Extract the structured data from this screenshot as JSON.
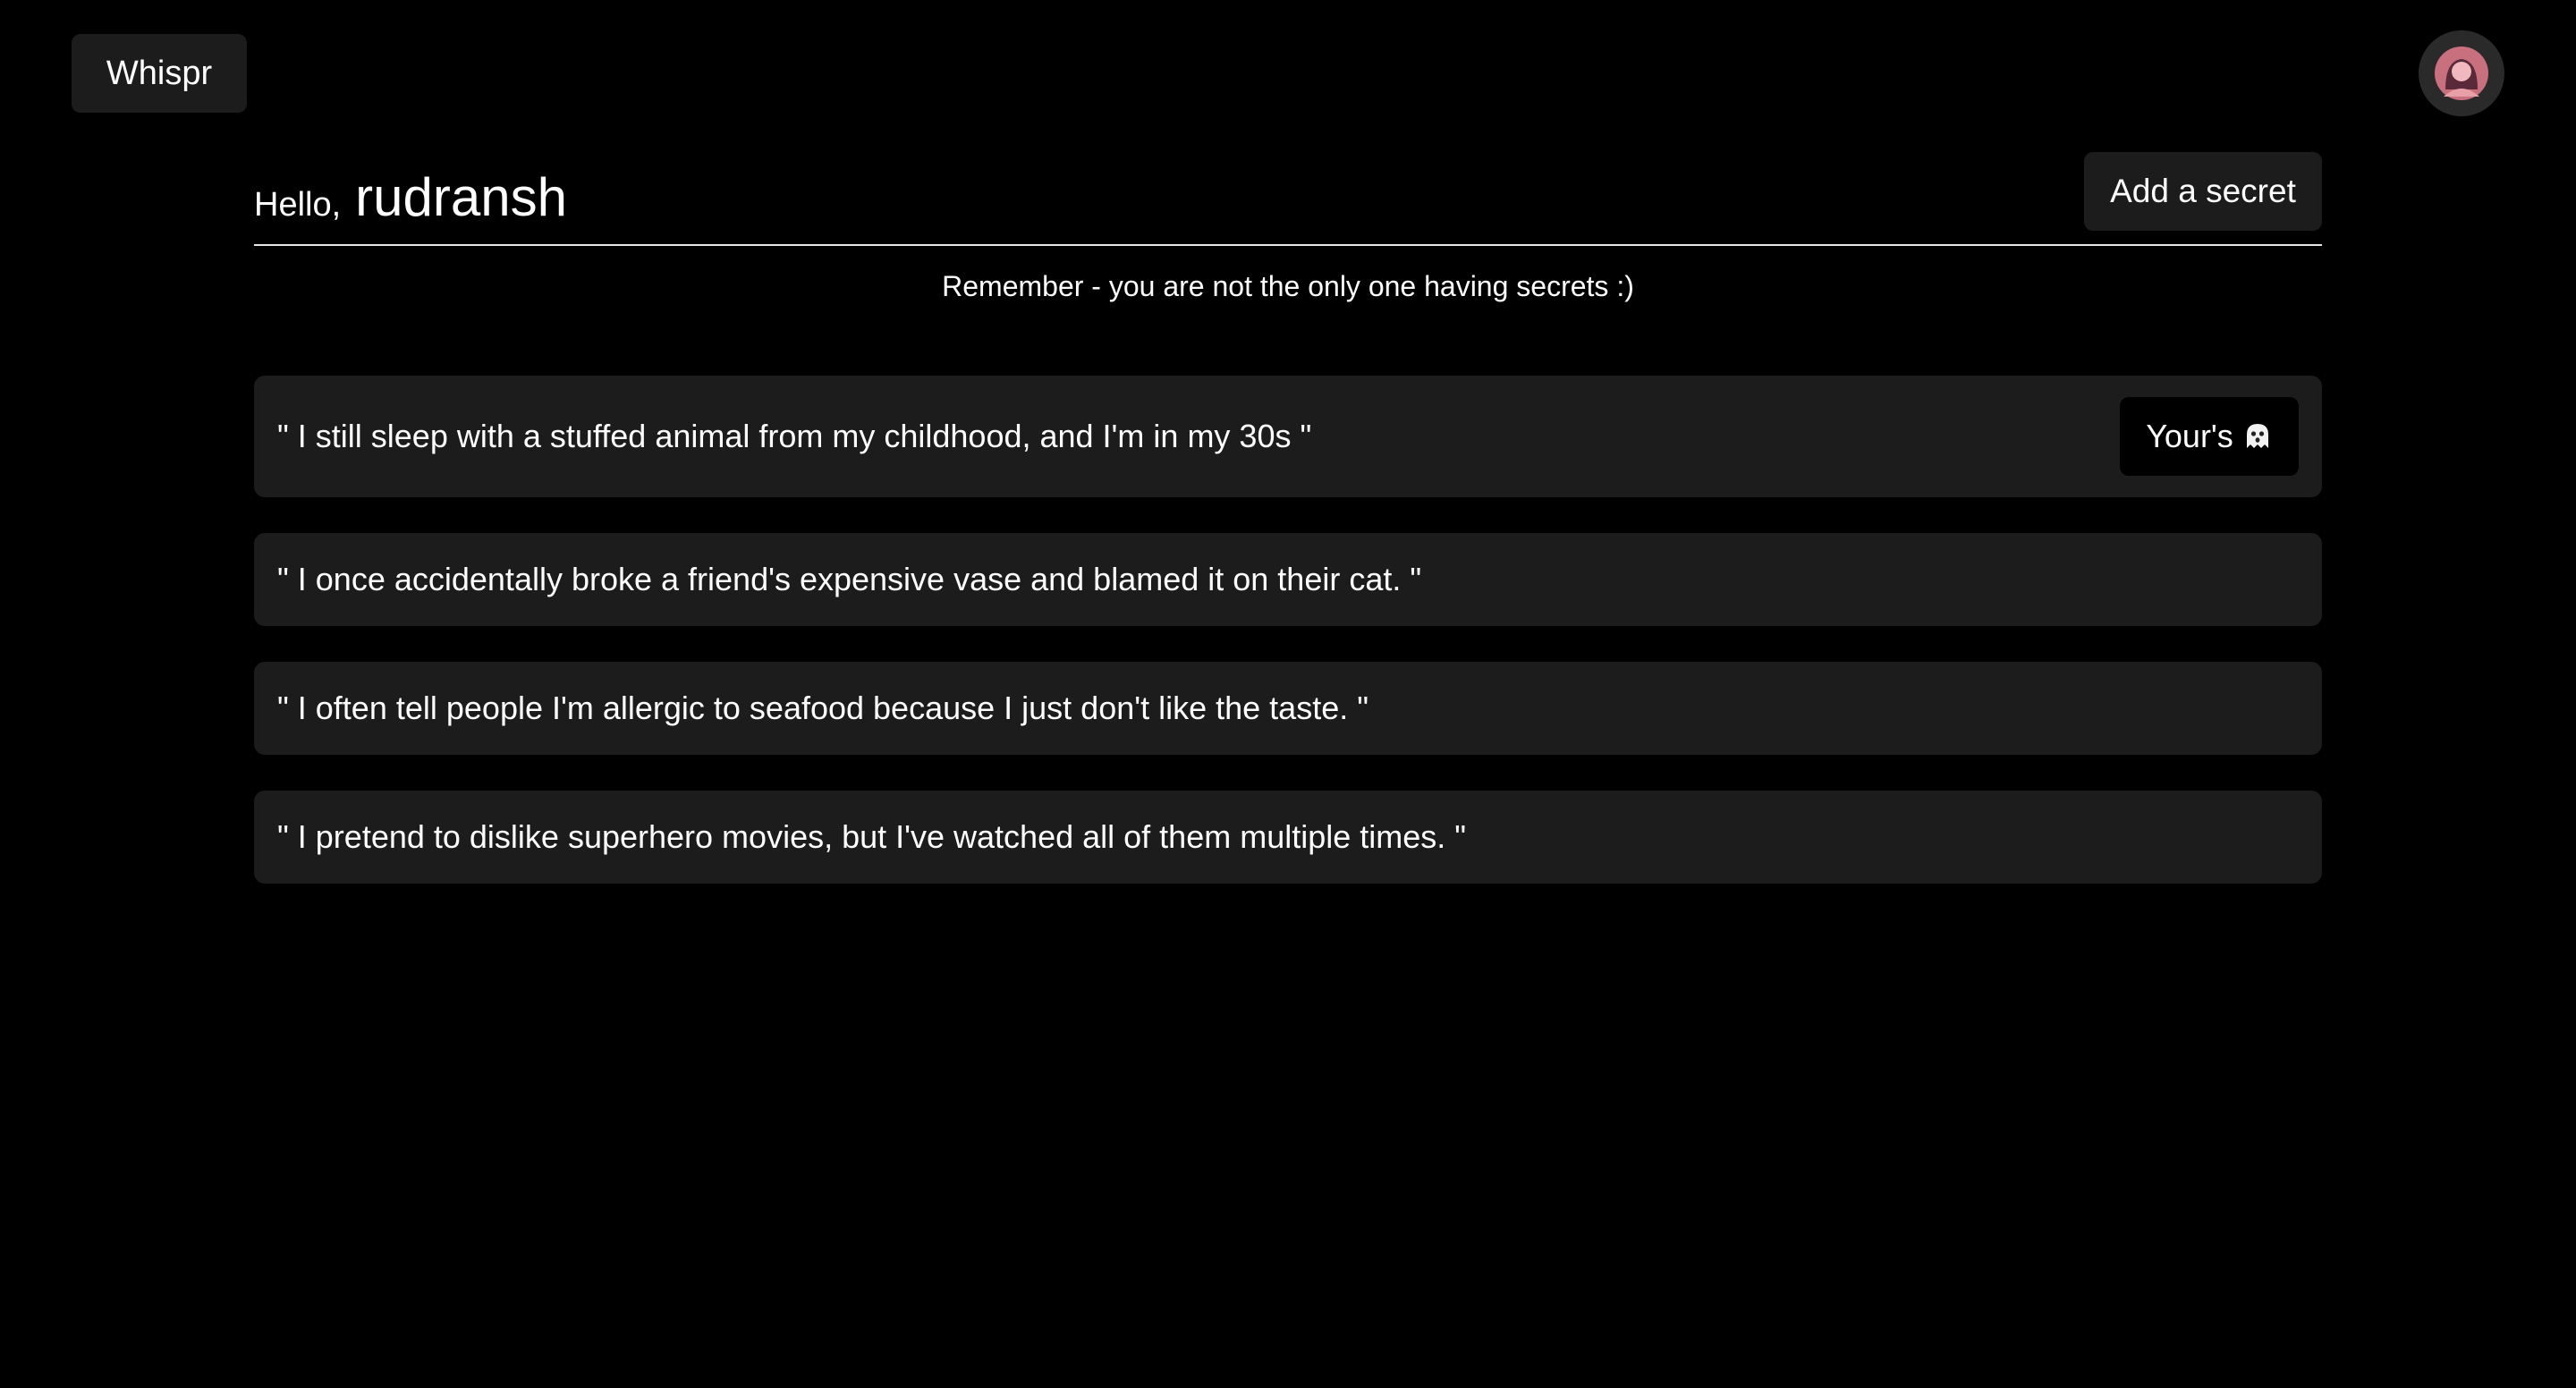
{
  "header": {
    "logo_label": "Whispr",
    "avatar_icon": "user-avatar-icon"
  },
  "greeting": {
    "hello": "Hello,",
    "username": "rudransh"
  },
  "actions": {
    "add_secret_label": "Add a secret"
  },
  "reminder": "Remember - you are not the only one having secrets :)",
  "secrets": [
    {
      "text": "\" I still sleep with a stuffed animal from my childhood, and I'm in my 30s \"",
      "badge": "Your's",
      "badge_icon": "ghost-icon"
    },
    {
      "text": "\" I once accidentally broke a friend's expensive vase and blamed it on their cat. \""
    },
    {
      "text": "\" I often tell people I'm allergic to seafood because I just don't like the taste. \""
    },
    {
      "text": "\" I pretend to dislike superhero movies, but I've watched all of them multiple times. \""
    }
  ],
  "colors": {
    "background": "#000000",
    "surface": "#1c1c1c",
    "text": "#ffffff",
    "avatar_skin": "#e8a0a8",
    "avatar_hair": "#5a2a3a"
  }
}
